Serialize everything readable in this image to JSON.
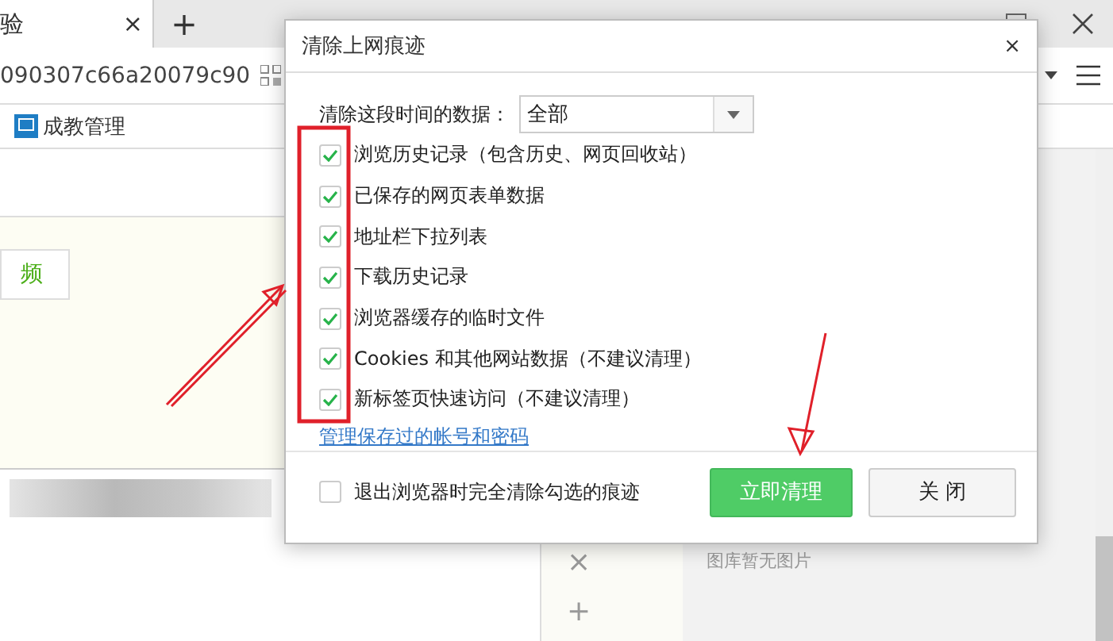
{
  "browser": {
    "tab": {
      "title": "验",
      "close": "×"
    },
    "new_tab": "+",
    "address": "090307c66a20079c90",
    "bookmarks": [
      {
        "label": "成教管理"
      }
    ],
    "page": {
      "video_button": "频",
      "empty_gallery": "图库暂无图片",
      "side_actions": [
        "×",
        "+"
      ]
    }
  },
  "dialog": {
    "title": "清除上网痕迹",
    "close": "×",
    "range_label": "清除这段时间的数据：",
    "range_value": "全部",
    "items": [
      {
        "label": "浏览历史记录（包含历史、网页回收站）",
        "checked": true
      },
      {
        "label": "已保存的网页表单数据",
        "checked": true
      },
      {
        "label": "地址栏下拉列表",
        "checked": true
      },
      {
        "label": "下载历史记录",
        "checked": true
      },
      {
        "label": "浏览器缓存的临时文件",
        "checked": true
      },
      {
        "label": "Cookies 和其他网站数据（不建议清理）",
        "checked": true
      },
      {
        "label": "新标签页快速访问（不建议清理）",
        "checked": true
      }
    ],
    "manage_link": "管理保存过的帐号和密码",
    "exit_option": {
      "label": "退出浏览器时完全清除勾选的痕迹",
      "checked": false
    },
    "buttons": [
      {
        "label": "立即清理",
        "kind": "primary"
      },
      {
        "label": "关 闭",
        "kind": "secondary"
      }
    ]
  }
}
